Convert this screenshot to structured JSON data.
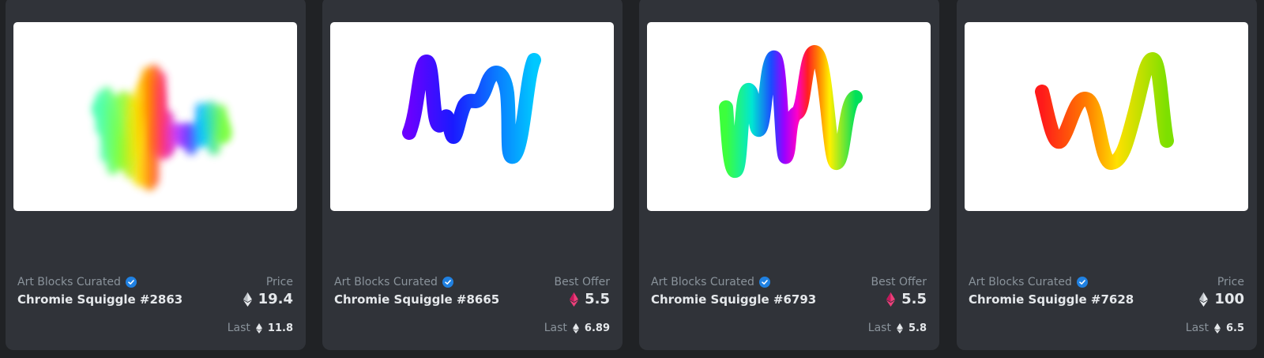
{
  "cards": [
    {
      "collection": "Art Blocks Curated",
      "name": "Chromie Squiggle #2863",
      "price_label": "Price",
      "price": "19.4",
      "price_icon": "eth-icon",
      "last_label": "Last",
      "last_price": "11.8"
    },
    {
      "collection": "Art Blocks Curated",
      "name": "Chromie Squiggle #8665",
      "price_label": "Best Offer",
      "price": "5.5",
      "price_icon": "weth-icon",
      "last_label": "Last",
      "last_price": "6.89"
    },
    {
      "collection": "Art Blocks Curated",
      "name": "Chromie Squiggle #6793",
      "price_label": "Best Offer",
      "price": "5.5",
      "price_icon": "weth-icon",
      "last_label": "Last",
      "last_price": "5.8"
    },
    {
      "collection": "Art Blocks Curated",
      "name": "Chromie Squiggle #7628",
      "price_label": "Price",
      "price": "100",
      "price_icon": "eth-icon",
      "last_label": "Last",
      "last_price": "6.5"
    }
  ],
  "colors": {
    "background": "#202225",
    "card": "#303339",
    "muted_text": "#8a939b",
    "primary_text": "#e5e8eb",
    "verified": "#2081e2",
    "weth": "#ec407a"
  }
}
